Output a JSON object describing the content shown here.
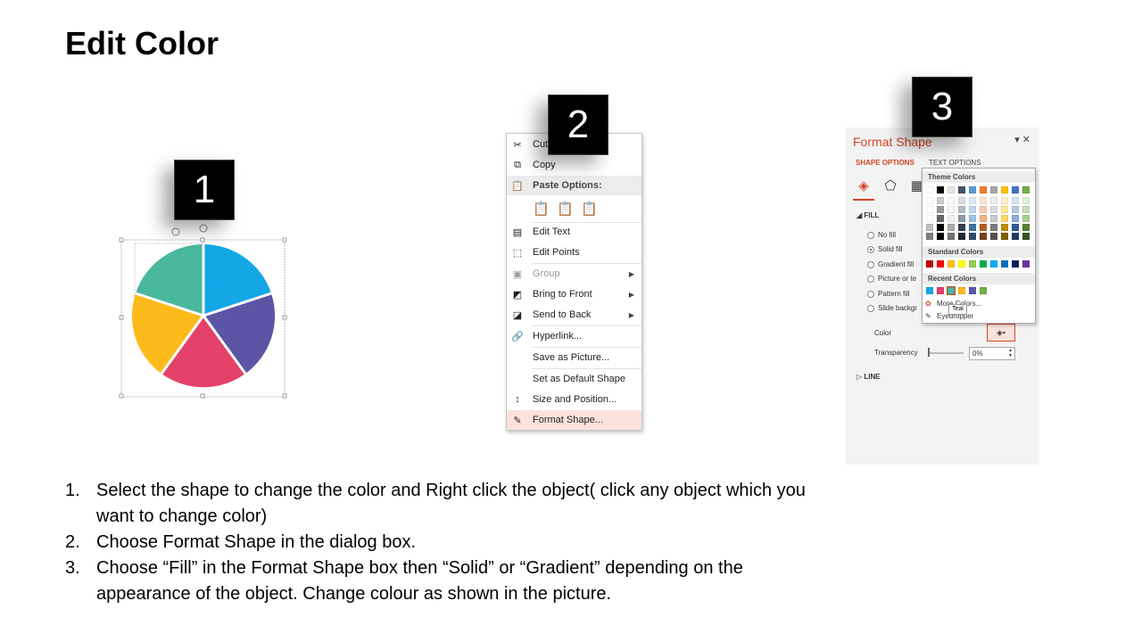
{
  "title": "Edit Color",
  "badges": [
    "1",
    "2",
    "3"
  ],
  "pie": {
    "colors": {
      "teal": "#4ab89d",
      "blue": "#13a7e6",
      "purple": "#5c55a6",
      "pink": "#e3416a",
      "yellow": "#fdbb1b"
    }
  },
  "context_menu": {
    "items": [
      {
        "label": "Cut",
        "icon": "scissors-icon"
      },
      {
        "label": "Copy",
        "icon": "copy-icon"
      },
      {
        "label": "Paste Options:",
        "icon": "paste-icon"
      },
      {
        "label": "",
        "icon": "paste-options-icons"
      },
      {
        "label": "Edit Text",
        "icon": "edit-text-icon"
      },
      {
        "label": "Edit Points",
        "icon": "edit-points-icon"
      },
      {
        "label": "Group",
        "icon": "group-icon"
      },
      {
        "label": "Bring to Front",
        "icon": "bring-front-icon"
      },
      {
        "label": "Send to Back",
        "icon": "send-back-icon"
      },
      {
        "label": "Hyperlink...",
        "icon": "hyperlink-icon"
      },
      {
        "label": "Save as Picture...",
        "icon": ""
      },
      {
        "label": "Set as Default Shape",
        "icon": ""
      },
      {
        "label": "Size and Position...",
        "icon": "size-position-icon"
      },
      {
        "label": "Format Shape...",
        "icon": "format-shape-icon"
      }
    ]
  },
  "format_pane": {
    "title": "Format Shape",
    "tabs": {
      "shape": "SHAPE OPTIONS",
      "text": "TEXT OPTIONS"
    },
    "fill_header": "FILL",
    "fill_options": [
      "No fill",
      "Solid fill",
      "Gradient fill",
      "Picture or te",
      "Pattern fill",
      "Slide backgr"
    ],
    "color_label": "Color",
    "transparency_label": "Transparency",
    "transparency_value": "0%",
    "line_header": "LINE",
    "accent": "#d24726"
  },
  "color_dropdown": {
    "theme_header": "Theme Colors",
    "standard_header": "Standard Colors",
    "recent_header": "Recent Colors",
    "more_colors": "More Colors...",
    "eyedropper": "Eyedropper",
    "tooltip": "Teal",
    "theme_top": [
      "#ffffff",
      "#000000",
      "#e7e6e6",
      "#44546a",
      "#5b9bd5",
      "#ed7d31",
      "#a5a5a5",
      "#ffc000",
      "#4472c4",
      "#70ad47"
    ],
    "standard": [
      "#c00000",
      "#ff0000",
      "#ffc000",
      "#ffff00",
      "#92d050",
      "#00b050",
      "#00b0f0",
      "#0070c0",
      "#002060",
      "#7030a0"
    ],
    "recent": [
      "#13a7e6",
      "#e3416a",
      "#4ab89d",
      "#fdbb1b",
      "#5c55a6",
      "#70ad47"
    ]
  },
  "instructions": [
    {
      "num": "1.",
      "lines": [
        "Select the shape to change the color and Right click the object( click any object which you",
        "want to change color)"
      ]
    },
    {
      "num": "2.",
      "lines": [
        "Choose Format Shape in the dialog box."
      ]
    },
    {
      "num": "3.",
      "lines": [
        "Choose “Fill” in the Format Shape box then “Solid” or “Gradient” depending on the",
        "appearance of the object. Change colour as shown in the picture."
      ]
    }
  ]
}
